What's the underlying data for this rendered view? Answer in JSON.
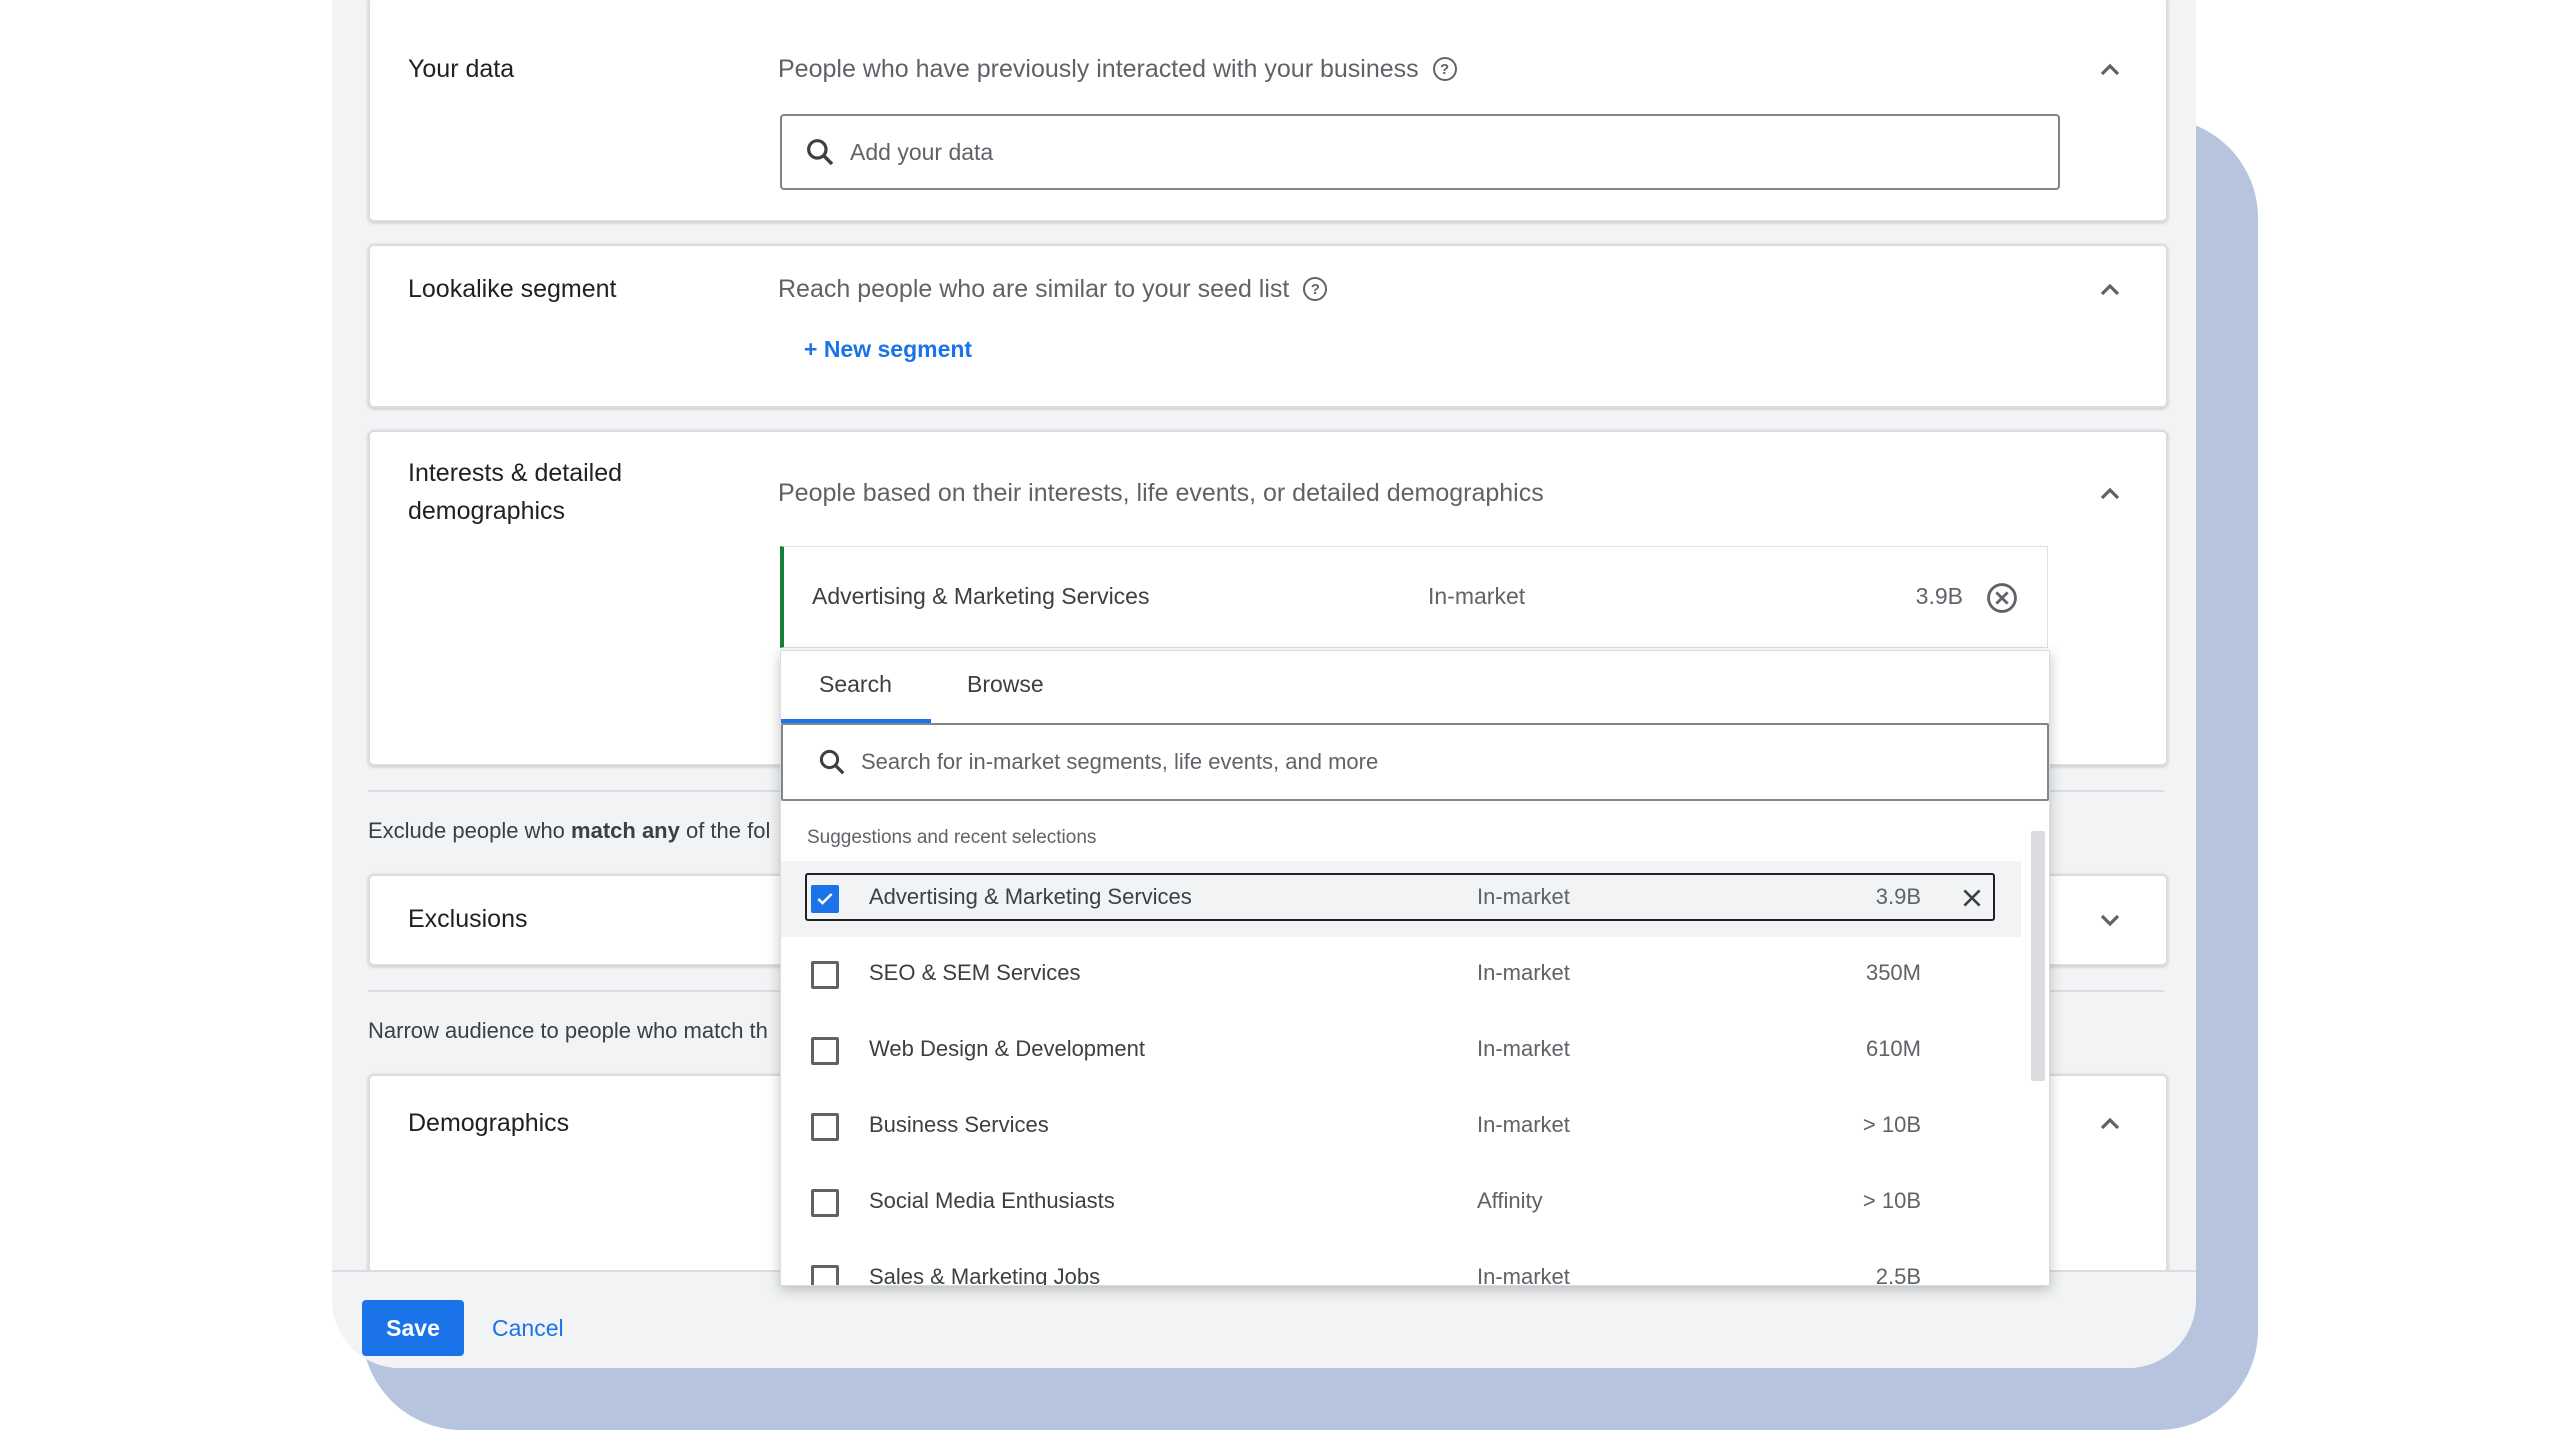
{
  "sections": {
    "your_data": {
      "title": "Your data",
      "description": "People who have previously interacted with your business",
      "search_placeholder": "Add your data"
    },
    "lookalike": {
      "title": "Lookalike segment",
      "description": "Reach people who are similar to your seed list",
      "new_segment": "+ New segment"
    },
    "interests": {
      "title": "Interests & detailed demographics",
      "description": "People based on their interests, life events, or detailed demographics",
      "selected": {
        "name": "Advertising & Marketing Services",
        "type": "In-market",
        "size": "3.9B"
      }
    },
    "exclude_text_prefix": "Exclude people who ",
    "exclude_text_bold": "match any",
    "exclude_text_suffix": " of the fol",
    "exclusions": {
      "title": "Exclusions"
    },
    "narrow_text": "Narrow audience to people who match th",
    "demographics": {
      "title": "Demographics"
    }
  },
  "dropdown": {
    "tabs": [
      "Search",
      "Browse"
    ],
    "search_placeholder": "Search for in-market segments, life events, and more",
    "caption": "Suggestions and recent selections",
    "rows": [
      {
        "name": "Advertising & Marketing Services",
        "type": "In-market",
        "size": "3.9B",
        "checked": true
      },
      {
        "name": "SEO & SEM Services",
        "type": "In-market",
        "size": "350M",
        "checked": false
      },
      {
        "name": "Web Design & Development",
        "type": "In-market",
        "size": "610M",
        "checked": false
      },
      {
        "name": "Business Services",
        "type": "In-market",
        "size": "> 10B",
        "checked": false
      },
      {
        "name": "Social Media Enthusiasts",
        "type": "Affinity",
        "size": "> 10B",
        "checked": false
      },
      {
        "name": "Sales & Marketing Jobs",
        "type": "In-market",
        "size": "2.5B",
        "checked": false
      }
    ]
  },
  "footer": {
    "save": "Save",
    "cancel": "Cancel"
  },
  "colors": {
    "accent": "#1a73e8",
    "selected_border": "#188038",
    "backdrop": "#b6c4de"
  }
}
